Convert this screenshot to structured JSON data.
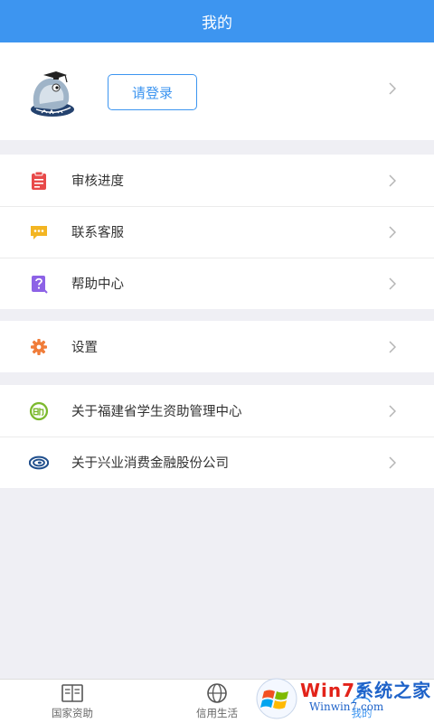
{
  "header": {
    "title": "我的"
  },
  "profile": {
    "login_label": "请登录"
  },
  "menu_groups": [
    {
      "items": [
        {
          "label": "审核进度",
          "icon": "clipboard-icon",
          "color": "#e84a4a"
        },
        {
          "label": "联系客服",
          "icon": "chat-bubble-icon",
          "color": "#f3b522"
        },
        {
          "label": "帮助中心",
          "icon": "question-icon",
          "color": "#8d62e6"
        }
      ]
    },
    {
      "items": [
        {
          "label": "设置",
          "icon": "gear-icon",
          "color": "#f07c39"
        }
      ]
    },
    {
      "items": [
        {
          "label": "关于福建省学生资助管理中心",
          "icon": "fujian-aid-logo-icon",
          "color": "#7cb92d"
        },
        {
          "label": "关于兴业消费金融股份公司",
          "icon": "xingye-logo-icon",
          "color": "#1f4e8c"
        }
      ]
    }
  ],
  "tabbar": {
    "tabs": [
      {
        "label": "国家资助",
        "icon": "book-icon"
      },
      {
        "label": "信用生活",
        "icon": "globe-icon"
      },
      {
        "label": "我的",
        "icon": "user-icon",
        "active": true
      }
    ]
  },
  "watermark": {
    "brand_prefix": "Win7",
    "brand_suffix": "系统之家",
    "domain": "Winwin7.com"
  },
  "colors": {
    "primary": "#3d95f0",
    "background": "#efeff4"
  }
}
